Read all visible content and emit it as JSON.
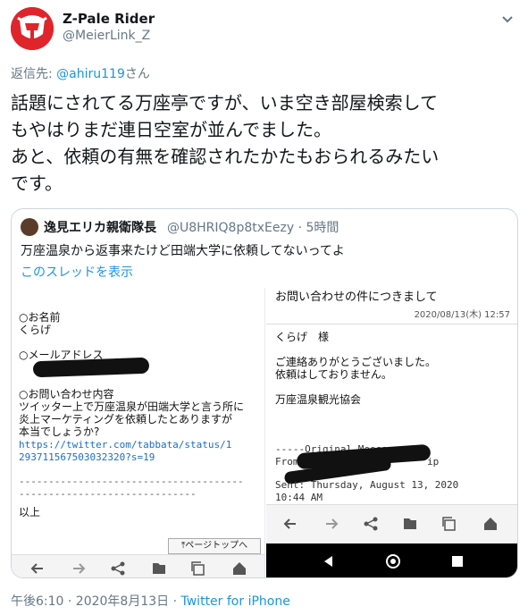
{
  "tweet": {
    "display_name": "Z-Pale Rider",
    "handle": "@MeierLink_Z",
    "reply_prefix": "返信先: ",
    "reply_to": "@ahiru119",
    "reply_suffix": "さん",
    "text": "話題にされてる万座亭ですが、いま空き部屋検索して\nもやはりまだ連日空室が並んでました。\nあと、依頼の有無を確認されたかたもおられるみたい\nです。",
    "timestamp": "午後6:10 · 2020年8月13日 · ",
    "source": "Twitter for iPhone"
  },
  "quote": {
    "name": "逸見エリカ親衛隊長",
    "handle_time": "@U8HRIQ8p8txEezy · 5時間",
    "text": "万座温泉から返事来たけど田端大学に依頼してないってよ",
    "thread_link": "このスレッドを表示"
  },
  "left_image": {
    "name_label": "○お名前",
    "name_value": "くらげ",
    "email_label": "○メールアドレス",
    "inquiry_label": "○お問い合わせ内容",
    "inquiry_lines": [
      "ツイッター上で万座温泉が田端大学と言う所に",
      "炎上マーケティングを依頼したとありますが",
      "本当でしょうか?"
    ],
    "url_lines": [
      "https://twitter.com/tabbata/status/1",
      "293711567503032320?s=19"
    ],
    "dash_line_1": "--------------------------------------",
    "dash_line_2": "------------------------------",
    "end_text": "以上",
    "page_top_button": "ページトップへ"
  },
  "right_image": {
    "subject": "お問い合わせの件につきまして",
    "date": "2020/08/13(木) 12:57",
    "salutation": "くらげ　様",
    "body_line_1": "ご連絡ありがとうございました。",
    "body_line_2": "依頼はしておりません。",
    "signature": "万座温泉観光協会",
    "original_message": "-----Original Message-----",
    "from_prefix": "From",
    "from_suffix": "ip",
    "sent_line": "Sent: Thursday, August 13, 2020",
    "sent_time": "10:44 AM"
  },
  "colors": {
    "link": "#1b95e0",
    "brand_avatar": "#e0242c",
    "secondary_text": "#657786",
    "border": "#ccd6dd"
  },
  "icons": {
    "caret": "chevron-down-icon",
    "back": "arrow-left-icon",
    "forward": "arrow-right-icon",
    "share": "share-icon",
    "bookmark": "bookmark-star-icon",
    "tabs": "tabs-count-icon",
    "home": "home-icon"
  }
}
